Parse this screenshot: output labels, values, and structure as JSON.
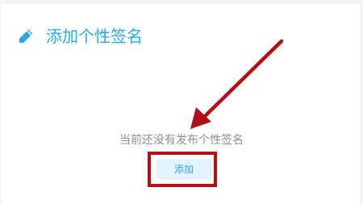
{
  "card": {
    "title": "添加个性签名",
    "empty_message": "当前还没有发布个性签名",
    "add_button_label": "添加"
  },
  "icons": {
    "title_icon": "pencil-icon"
  },
  "annotation": {
    "highlight_color": "#b01117",
    "arrow_color": "#b01117"
  },
  "colors": {
    "accent": "#2aa8e6",
    "button_bg": "#e3f4fc",
    "muted_text": "#8a8f99"
  }
}
